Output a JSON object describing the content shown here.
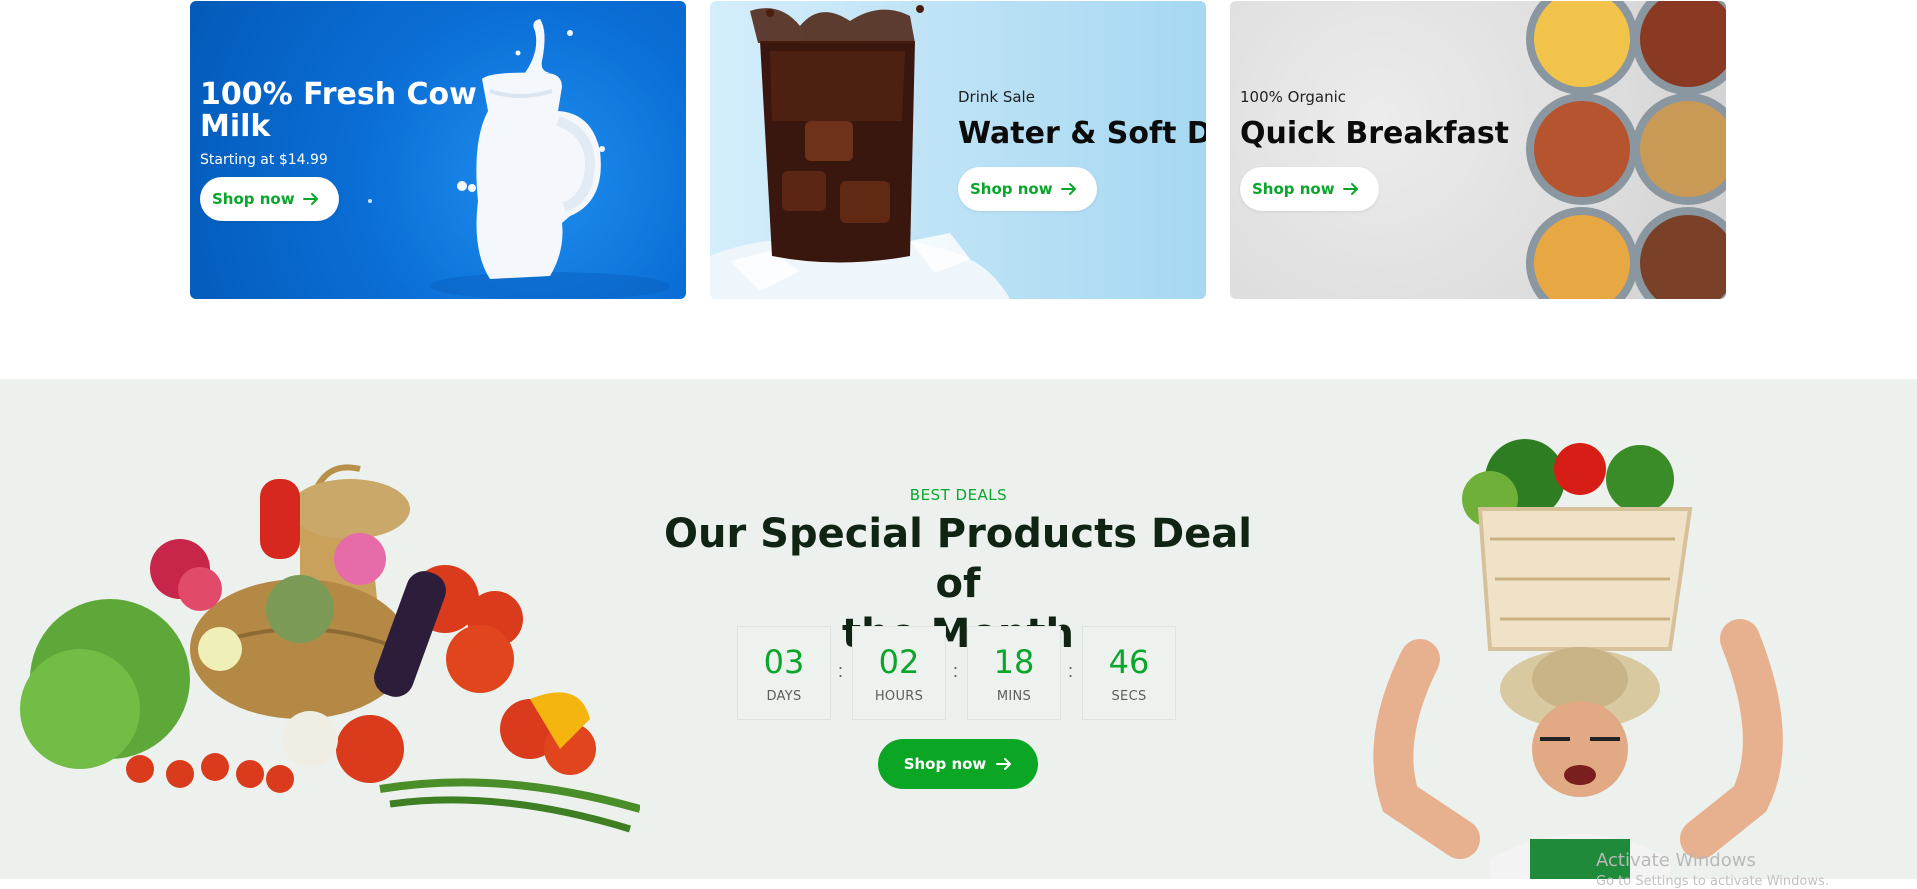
{
  "banners": [
    {
      "subtitle": "",
      "title_line1": "100% Fresh Cow",
      "title_line2": "Milk",
      "price_text": "Starting at $14.99",
      "button_label": "Shop now"
    },
    {
      "subtitle": "Drink Sale",
      "title_line1": "Water & Soft Dr",
      "button_label": "Shop now"
    },
    {
      "subtitle": "100% Organic",
      "title_line1": "Quick Breakfast",
      "button_label": "Shop now"
    }
  ],
  "deal": {
    "eyebrow": "BEST DEALS",
    "title_line1": "Our Special Products Deal of",
    "title_line2": "the Month",
    "countdown": [
      {
        "value": "03",
        "label": "DAYS"
      },
      {
        "value": "02",
        "label": "HOURS"
      },
      {
        "value": "18",
        "label": "MINS"
      },
      {
        "value": "46",
        "label": "SECS"
      }
    ],
    "separator": ":",
    "button_label": "Shop now"
  },
  "watermark": {
    "title": "Activate Windows",
    "subtitle": "Go to Settings to activate Windows."
  },
  "colors": {
    "accent": "#0aa62c",
    "deal_bg": "#edf1ed",
    "title": "#0f2412"
  },
  "icons": {
    "arrow": "arrow-right-icon"
  }
}
